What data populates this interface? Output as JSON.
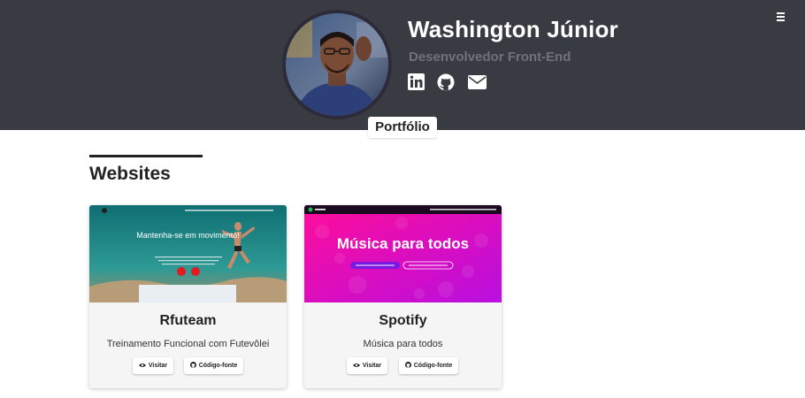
{
  "header": {
    "name": "Washington Júnior",
    "role": "Desenvolvedor Front-End",
    "menu_icon": "hamburger-menu-icon",
    "social": [
      {
        "icon": "linkedin-icon"
      },
      {
        "icon": "github-icon"
      },
      {
        "icon": "envelope-icon"
      }
    ],
    "portfolio_tab": "Portfólio"
  },
  "section": {
    "title": "Websites"
  },
  "projects": [
    {
      "title": "Rfuteam",
      "description": "Treinamento Funcional com Futevôlei",
      "thumb_headline": "Mantenha-se em movimento!",
      "visit_label": "Visitar",
      "source_label": "Código-fonte"
    },
    {
      "title": "Spotify",
      "description": "Música para todos",
      "thumb_headline": "Música para todos",
      "visit_label": "Visitar",
      "source_label": "Código-fonte"
    }
  ],
  "colors": {
    "header_bg": "#393b42",
    "role_text": "#6e727b",
    "card_bg": "#f5f5f5",
    "spotify_gradient_start": "#ff0d9a",
    "spotify_gradient_end": "#b80fe0",
    "rfuteam_sky": "#0f7a7a"
  }
}
